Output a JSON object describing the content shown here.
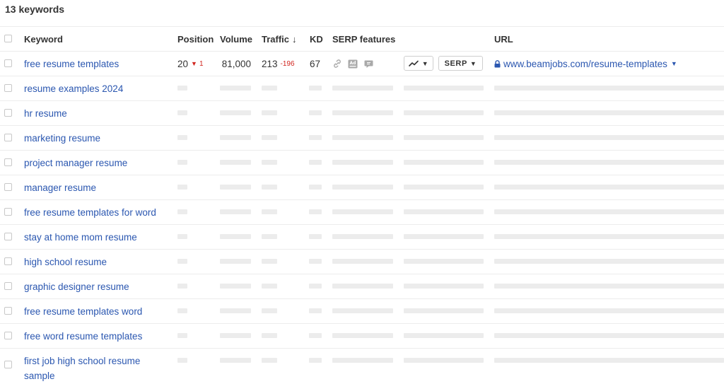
{
  "header": {
    "title": "13 keywords"
  },
  "columns": {
    "keyword": "Keyword",
    "position": "Position",
    "volume": "Volume",
    "traffic": "Traffic",
    "traffic_sort": "↓",
    "kd": "KD",
    "serp_features": "SERP features",
    "url": "URL"
  },
  "first_row": {
    "keyword": "free resume templates",
    "position": "20",
    "position_change": "1",
    "volume": "81,000",
    "traffic": "213",
    "traffic_change": "-196",
    "kd": "67",
    "serp_icons": [
      "link-icon",
      "ad-icon",
      "comment-icon"
    ],
    "chart_button_icon": "trend-icon",
    "serp_button": "SERP",
    "url": "www.beamjobs.com/resume-templates"
  },
  "keywords": [
    "resume examples 2024",
    "hr resume",
    "marketing resume",
    "project manager resume",
    "manager resume",
    "free resume templates for word",
    "stay at home mom resume",
    "high school resume",
    "graphic designer resume",
    "free resume templates word",
    "free word resume templates",
    "first job high school resume sample"
  ],
  "colors": {
    "link": "#2b57b0",
    "negative": "#d1261f",
    "placeholder": "#ececec"
  }
}
